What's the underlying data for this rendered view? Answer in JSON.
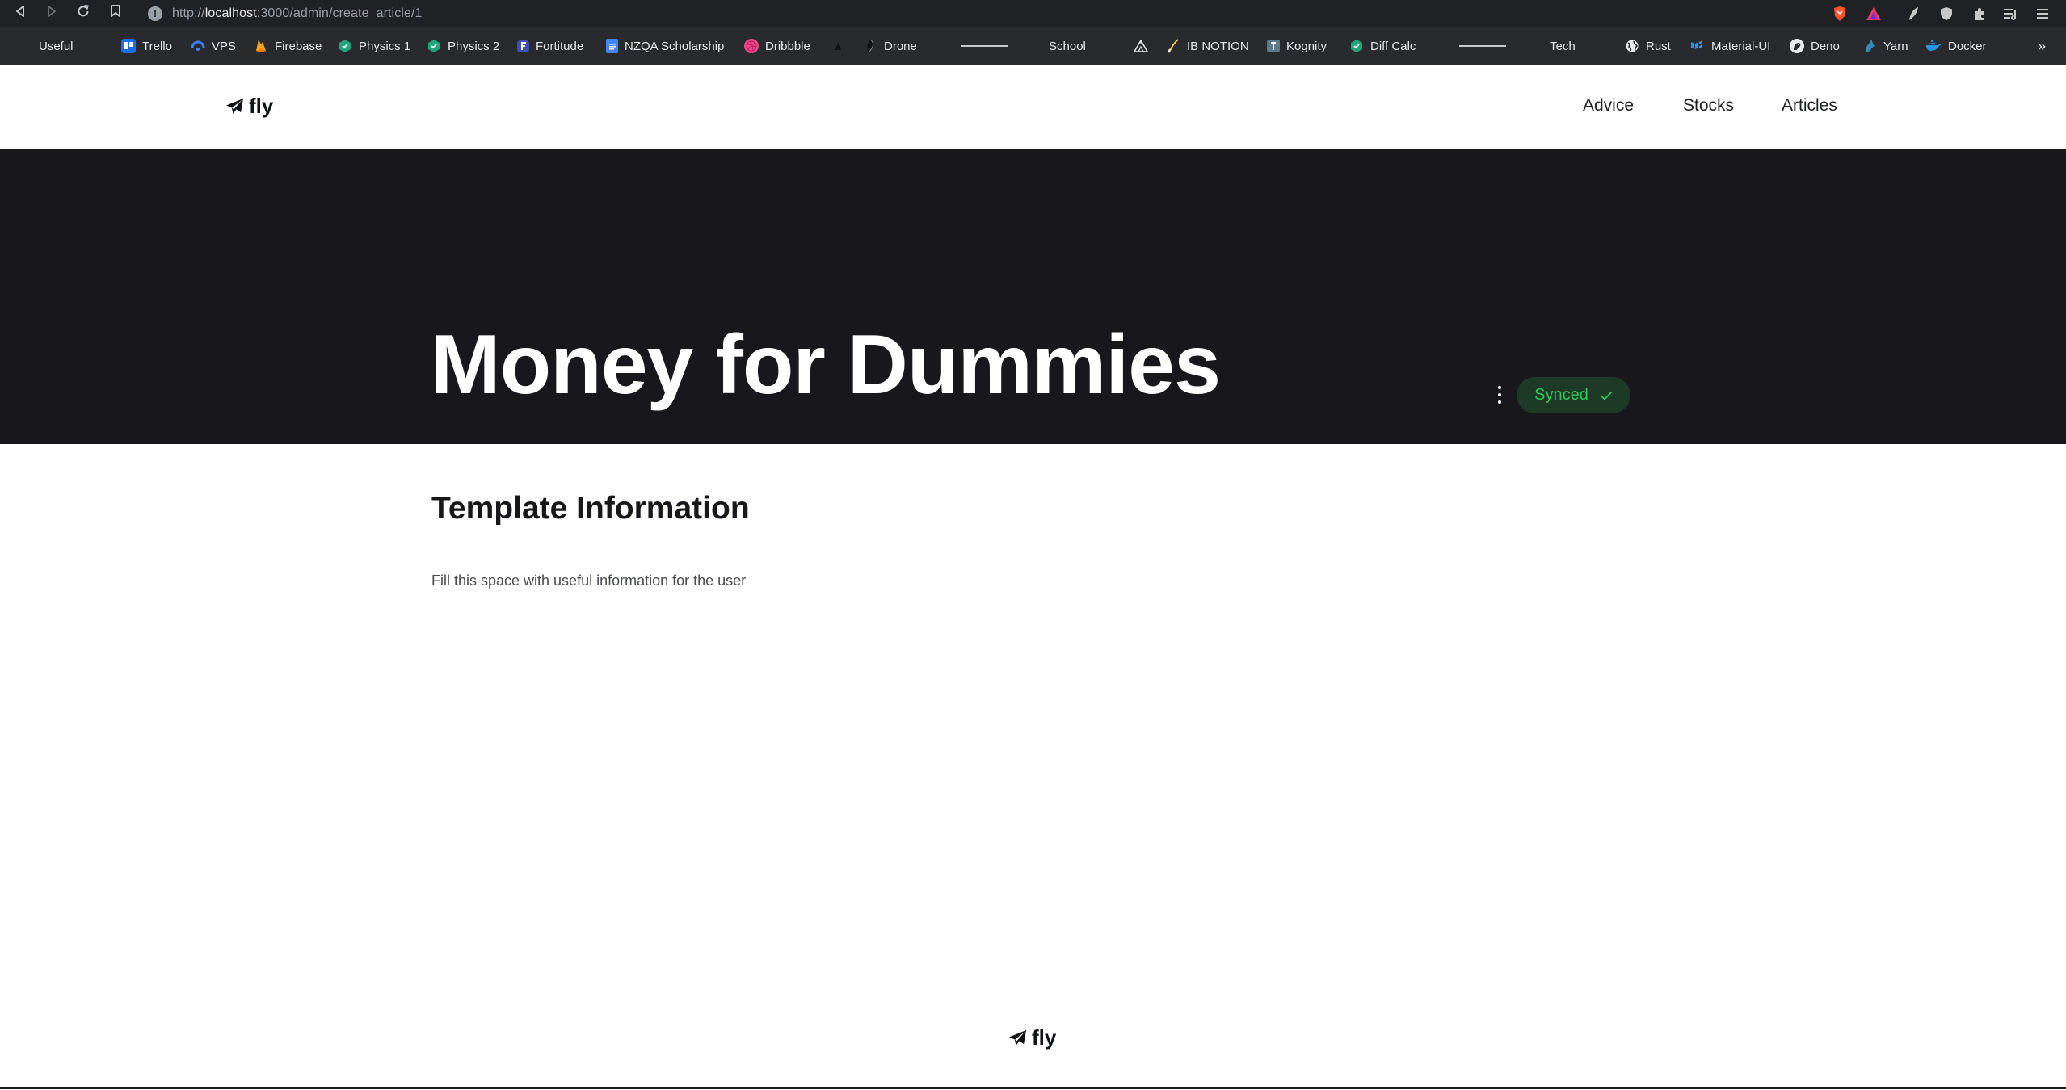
{
  "browser": {
    "url_prefix": "http://",
    "url_host": "localhost",
    "url_path": ":3000/admin/create_article/1",
    "url_info_glyph": "!",
    "more_glyph": "»",
    "bookmarks": [
      {
        "label": "Useful",
        "icon": "folder-icon"
      },
      {
        "label": "Trello",
        "icon": "trello-icon",
        "color": "#1f6feb"
      },
      {
        "label": "VPS",
        "icon": "vps-icon",
        "color": "#3b82f6"
      },
      {
        "label": "Firebase",
        "icon": "firebase-icon",
        "color": "#f5a623"
      },
      {
        "label": "Physics 1",
        "icon": "physics-icon",
        "color": "#21a67a"
      },
      {
        "label": "Physics 2",
        "icon": "physics-icon",
        "color": "#21a67a"
      },
      {
        "label": "Fortitude",
        "icon": "fortitude-icon",
        "color": "#3f51b5"
      },
      {
        "label": "NZQA Scholarship",
        "icon": "docs-icon",
        "color": "#4285f4"
      },
      {
        "label": "Dribbble",
        "icon": "dribbble-icon",
        "color": "#ea4c89"
      },
      {
        "label": "Drone",
        "icon": "drone-icon",
        "color": "#111111"
      },
      {
        "label": "School",
        "icon": "separator-folder-icon"
      },
      {
        "label": "IB NOTION",
        "icon": "notion-icon",
        "color": "#ffffff"
      },
      {
        "label": "Kognity",
        "icon": "kognity-icon",
        "color": "#5b7b8c"
      },
      {
        "label": "Diff Calc",
        "icon": "calc-icon",
        "color": "#21a67a"
      },
      {
        "label": "Tech",
        "icon": "separator-folder-icon"
      },
      {
        "label": "Rust",
        "icon": "globe-icon",
        "color": "#e8eaed"
      },
      {
        "label": "Material-UI",
        "icon": "material-ui-icon",
        "color": "#2196f3"
      },
      {
        "label": "Deno",
        "icon": "deno-icon",
        "color": "#e8eaed"
      },
      {
        "label": "Yarn",
        "icon": "yarn-icon",
        "color": "#2c8ebb"
      },
      {
        "label": "Docker",
        "icon": "docker-icon",
        "color": "#2496ed"
      }
    ]
  },
  "site": {
    "logo_text": "fly",
    "nav": [
      {
        "label": "Advice"
      },
      {
        "label": "Stocks"
      },
      {
        "label": "Articles"
      }
    ]
  },
  "hero": {
    "title": "Money for Dummies",
    "status_label": "Synced",
    "status_color": "#32c75a"
  },
  "section": {
    "title": "Template Information",
    "body": "Fill this space with useful information for the user"
  },
  "footer": {
    "logo_text": "fly"
  }
}
